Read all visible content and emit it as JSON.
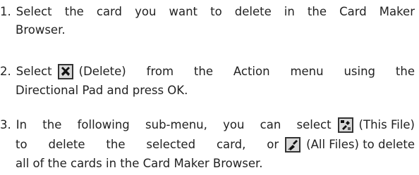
{
  "steps": [
    {
      "number": "1.",
      "line1_text": "Select the card you want to delete in the Card Maker",
      "line2_text": "Browser."
    },
    {
      "number": "2.",
      "line1_before_icon": "Select",
      "line1_after_icon": "(Delete) from the Action menu using the",
      "line2_text": "Directional Pad and press OK.",
      "icon": "delete-x-icon"
    },
    {
      "number": "3.",
      "line1_before_icon": "In the following sub-menu, you can select",
      "line1_after_icon": "(This File)",
      "line1_icon": "this-file-icon",
      "line2_before_icon": "to delete the selected card, or",
      "line2_after_icon": "(All Files) to delete",
      "line2_icon": "all-files-icon",
      "line3_text": "all of the cards in the Card Maker Browser."
    }
  ],
  "colors": {
    "text": "#222222",
    "icon_border": "#333333",
    "icon_background": "#d9d9d9",
    "icon_dark": "#111111"
  }
}
